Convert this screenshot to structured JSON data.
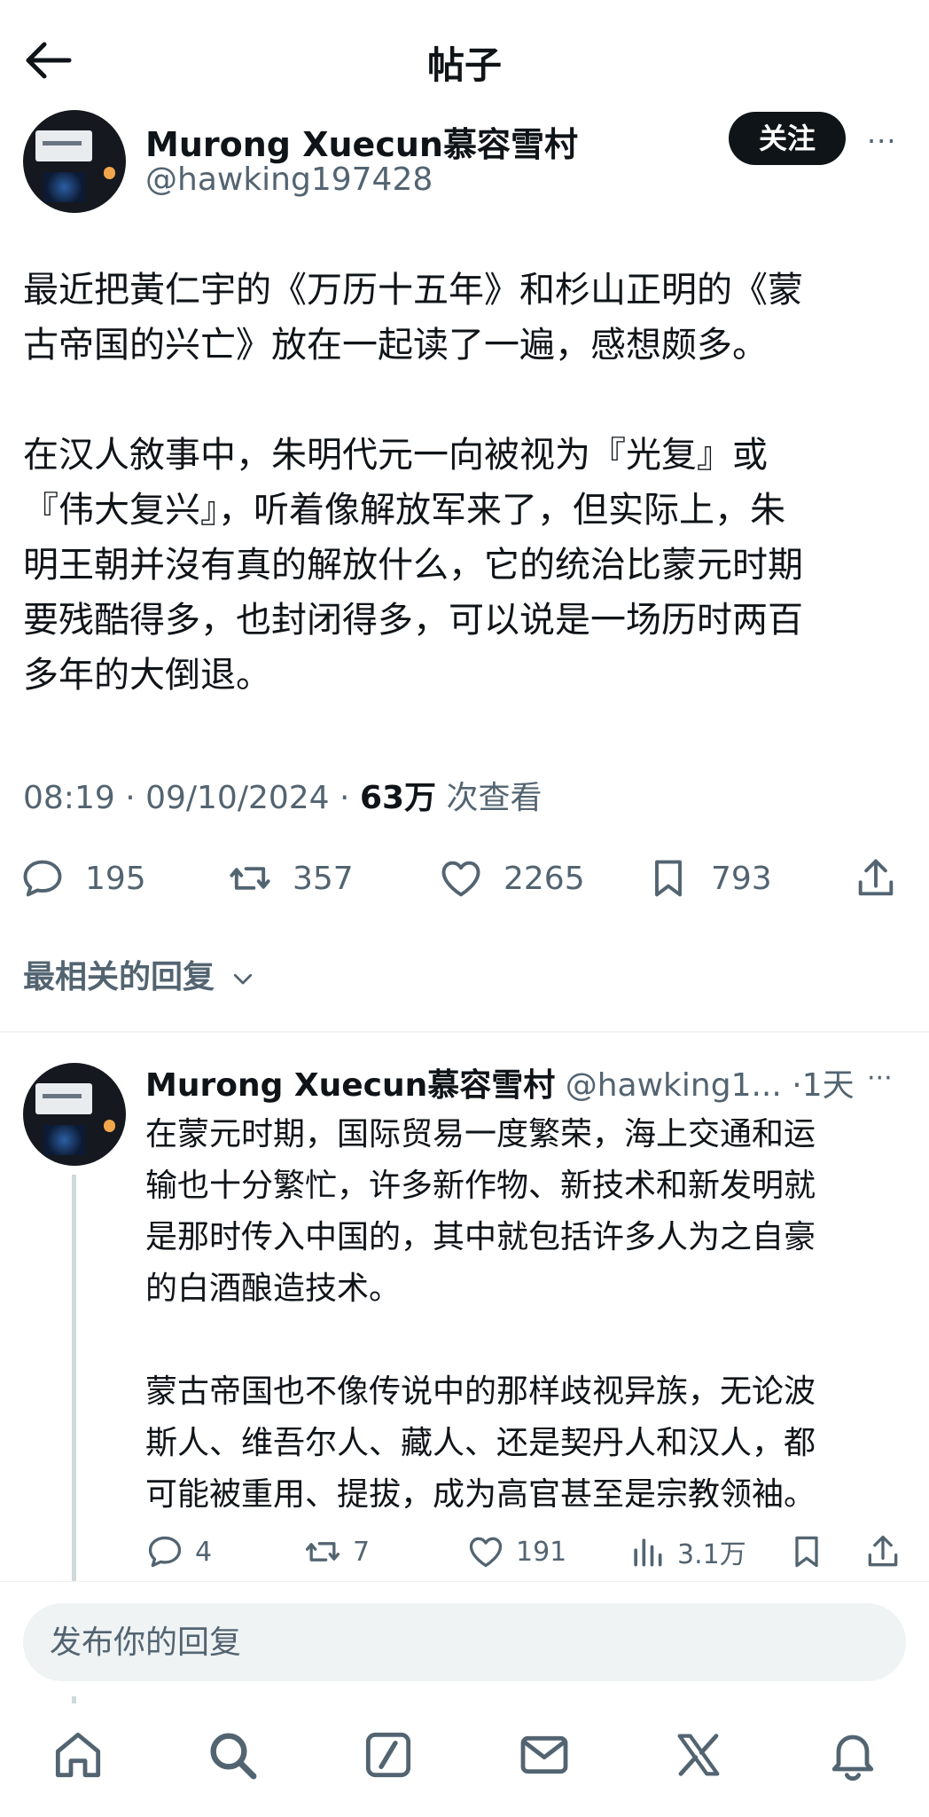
{
  "header": {
    "title": "帖子"
  },
  "post": {
    "author_name": "Murong Xuecun慕容雪村",
    "author_handle": "@hawking197428",
    "follow_label": "关注",
    "more_label": "···",
    "body_lines": [
      "最近把黃仁宇的《万历十五年》和杉山正明的《蒙",
      "古帝国的兴亡》放在一起读了一遍，感想颇多。",
      "",
      "在汉人敘事中，朱明代元一向被视为『光复』或",
      "『伟大复兴』，听着像解放军来了，但实际上，朱",
      "明王朝并沒有真的解放什么，它的统治比蒙元时期",
      "要残酷得多，也封闭得多，可以说是一场历时两百",
      "多年的大倒退。"
    ],
    "time": "08:19",
    "date": "09/10/2024",
    "views_count": "63万",
    "views_label": "次查看",
    "stats": {
      "replies": "195",
      "reposts": "357",
      "likes": "2265",
      "bookmarks": "793"
    }
  },
  "replies_sort_label": "最相关的回复",
  "reply": {
    "author_name": "Murong Xuecun慕容雪村",
    "author_handle": "@hawking1...",
    "time_ago": "1天",
    "more_label": "···",
    "body_lines": [
      "在蒙元时期，国际贸易一度繁荣，海上交通和运",
      "输也十分繁忙，许多新作物、新技术和新发明就",
      "是那时传入中国的，其中就包括许多人为之自豪",
      "的白酒酿造技术。",
      "",
      "蒙古帝国也不像传说中的那样歧视异族，无论波",
      "斯人、维吾尔人、藏人、还是契丹人和汉人，都",
      "可能被重用、提拔，成为高官甚至是宗教领袖。"
    ],
    "stats": {
      "replies": "4",
      "reposts": "7",
      "likes": "191",
      "views": "3.1万"
    }
  },
  "composer": {
    "placeholder": "发布你的回复"
  },
  "icons": {
    "back": "arrow-left-icon",
    "reply": "speech-bubble-icon",
    "repost": "repost-arrows-icon",
    "like": "heart-icon",
    "bookmark": "bookmark-icon",
    "share": "share-upload-icon",
    "views": "bar-chart-icon",
    "home": "home-icon",
    "search": "search-icon",
    "compose": "compose-slash-icon",
    "messages": "envelope-icon",
    "grok": "x-logo-icon",
    "notifications": "bell-icon"
  },
  "colors": {
    "text": "#0f1419",
    "secondary": "#536471",
    "divider": "#eff3f4",
    "button": "#0f1419"
  }
}
